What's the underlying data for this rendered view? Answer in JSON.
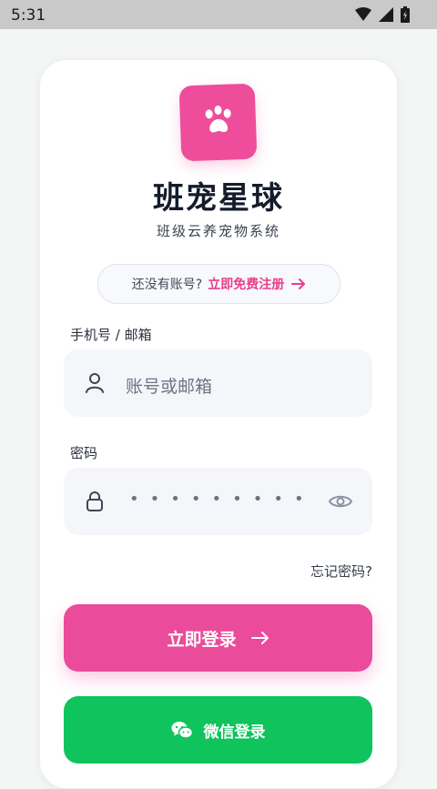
{
  "status_bar": {
    "time": "5:31"
  },
  "app": {
    "name": "班宠星球",
    "tagline": "班级云养宠物系统"
  },
  "register_prompt": {
    "question": "还没有账号?",
    "link": "立即免费注册"
  },
  "account": {
    "label": "手机号 / 邮箱",
    "placeholder": "账号或邮箱"
  },
  "password": {
    "label": "密码",
    "masked_value": "•••••••••"
  },
  "forgot_password": "忘记密码?",
  "login_button": "立即登录",
  "wechat_button": "微信登录",
  "colors": {
    "brand_pink": "#eb4b9b",
    "wechat_green": "#0fc35d"
  }
}
